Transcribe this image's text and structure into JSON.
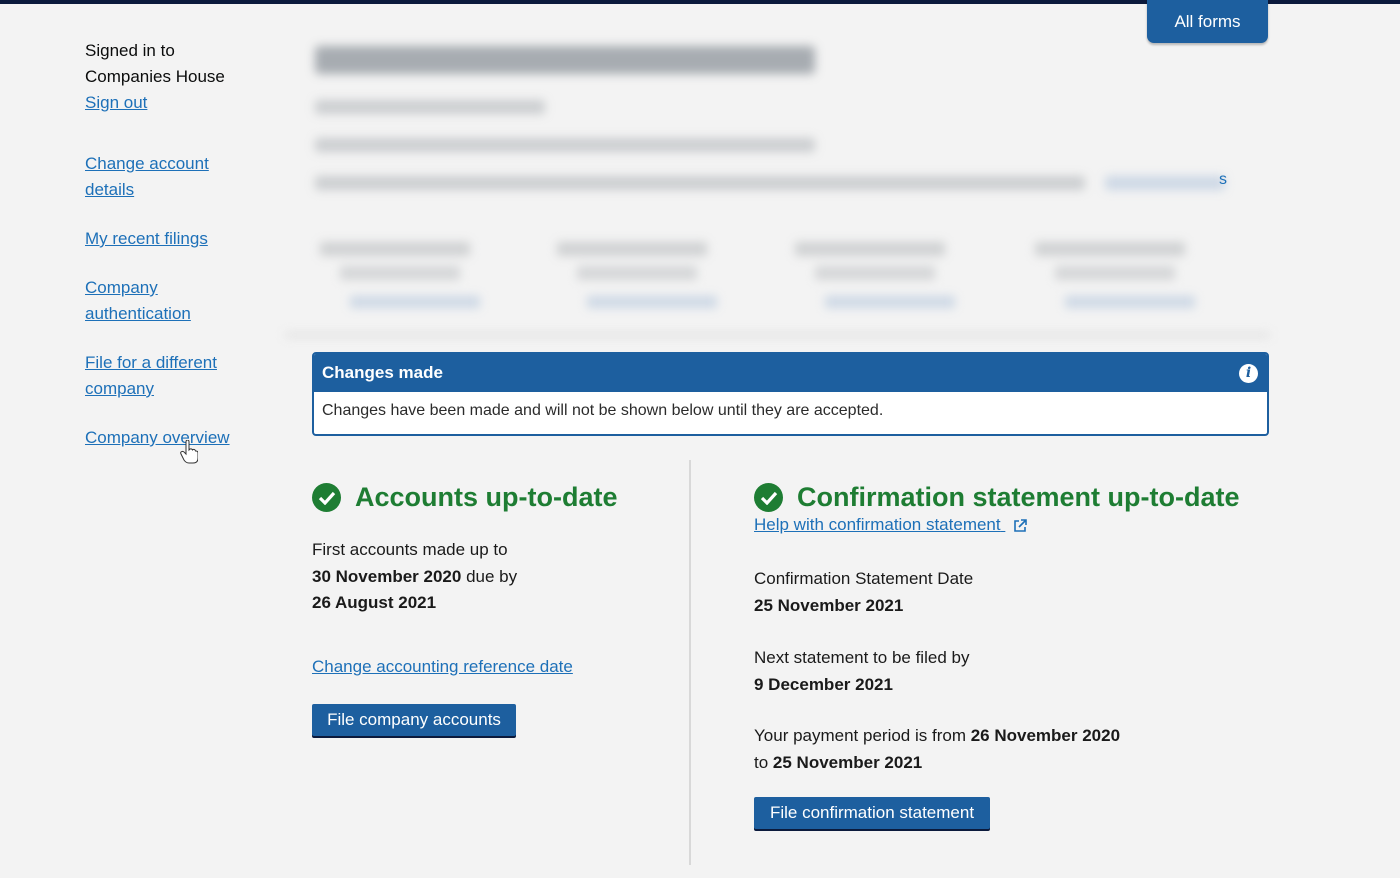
{
  "sidebar": {
    "signed_in_line1": "Signed in to",
    "signed_in_line2": "Companies House",
    "sign_out": "Sign out",
    "nav": [
      {
        "line1": "Change account",
        "line2": "details"
      },
      {
        "line1": "My recent filings"
      },
      {
        "line1": "Company",
        "line2": "authentication"
      },
      {
        "line1": "File for a different",
        "line2": "company"
      },
      {
        "line1": "Company overview"
      }
    ]
  },
  "header": {
    "all_forms": "All forms",
    "stray_text": "s"
  },
  "banner": {
    "title": "Changes made",
    "message": "Changes have been made and will not be shown below until they are accepted."
  },
  "accounts": {
    "heading": "Accounts up-to-date",
    "line1": "First accounts made up to",
    "made_up_to": "30 November 2020",
    "due_by_label": "due by",
    "due_date": "26 August 2021",
    "change_link": "Change accounting reference date",
    "file_button": "File company accounts"
  },
  "confirmation": {
    "heading": "Confirmation statement up-to-date",
    "help_link": "Help with confirmation statement",
    "date_label": "Confirmation Statement Date",
    "date_value": "25 November 2021",
    "next_label": "Next statement to be filed by",
    "next_value": "9 December 2021",
    "period_prefix": "Your payment period is from",
    "period_from": "26 November 2020",
    "period_to_label": "to",
    "period_to": "25 November 2021",
    "file_button": "File confirmation statement"
  },
  "colors": {
    "brand_blue": "#1d5f9f",
    "link_blue": "#1d70b8",
    "success_green": "#1e7d33"
  },
  "icons": [
    "info-icon",
    "check-circle-icon",
    "external-link-icon",
    "hand-cursor-icon"
  ]
}
